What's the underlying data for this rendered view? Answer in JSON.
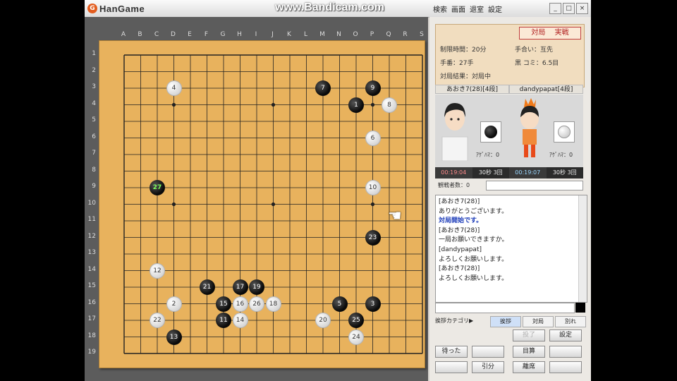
{
  "app": {
    "logo_text": "HanGame",
    "watermark": "www.Bandicam.com"
  },
  "menu": {
    "items": [
      "検索",
      "画面",
      "退室",
      "設定"
    ],
    "window_buttons": [
      "_",
      "□",
      "×"
    ]
  },
  "board": {
    "col_labels": [
      "A",
      "B",
      "C",
      "D",
      "E",
      "F",
      "G",
      "H",
      "I",
      "J",
      "K",
      "L",
      "M",
      "N",
      "O",
      "P",
      "Q",
      "R",
      "S"
    ],
    "row_labels": [
      "1",
      "2",
      "3",
      "4",
      "5",
      "6",
      "7",
      "8",
      "9",
      "10",
      "11",
      "12",
      "13",
      "14",
      "15",
      "16",
      "17",
      "18",
      "19"
    ],
    "stones": [
      {
        "n": "1",
        "color": "b",
        "col": 15,
        "row": 4
      },
      {
        "n": "2",
        "color": "w",
        "col": 4,
        "row": 16
      },
      {
        "n": "3",
        "color": "b",
        "col": 16,
        "row": 16
      },
      {
        "n": "4",
        "color": "w",
        "col": 4,
        "row": 3
      },
      {
        "n": "5",
        "color": "b",
        "col": 14,
        "row": 16
      },
      {
        "n": "6",
        "color": "w",
        "col": 16,
        "row": 6
      },
      {
        "n": "7",
        "color": "b",
        "col": 13,
        "row": 3
      },
      {
        "n": "8",
        "color": "w",
        "col": 17,
        "row": 4
      },
      {
        "n": "9",
        "color": "b",
        "col": 16,
        "row": 3
      },
      {
        "n": "10",
        "color": "w",
        "col": 16,
        "row": 9
      },
      {
        "n": "11",
        "color": "b",
        "col": 7,
        "row": 17
      },
      {
        "n": "12",
        "color": "w",
        "col": 3,
        "row": 14
      },
      {
        "n": "13",
        "color": "b",
        "col": 4,
        "row": 18
      },
      {
        "n": "14",
        "color": "w",
        "col": 8,
        "row": 17
      },
      {
        "n": "15",
        "color": "b",
        "col": 7,
        "row": 16
      },
      {
        "n": "16",
        "color": "w",
        "col": 8,
        "row": 16
      },
      {
        "n": "17",
        "color": "b",
        "col": 8,
        "row": 15
      },
      {
        "n": "18",
        "color": "w",
        "col": 10,
        "row": 16
      },
      {
        "n": "19",
        "color": "b",
        "col": 9,
        "row": 15
      },
      {
        "n": "20",
        "color": "w",
        "col": 13,
        "row": 17
      },
      {
        "n": "21",
        "color": "b",
        "col": 6,
        "row": 15
      },
      {
        "n": "22",
        "color": "w",
        "col": 3,
        "row": 17
      },
      {
        "n": "23",
        "color": "b",
        "col": 16,
        "row": 12
      },
      {
        "n": "24",
        "color": "w",
        "col": 15,
        "row": 18
      },
      {
        "n": "25",
        "color": "b",
        "col": 15,
        "row": 17
      },
      {
        "n": "26",
        "color": "w",
        "col": 9,
        "row": 16
      },
      {
        "n": "27",
        "color": "b",
        "col": 3,
        "row": 9,
        "last": true
      }
    ]
  },
  "panel": {
    "stamp": "対局 　実戦",
    "info": {
      "time_limit": "制限時間：20分",
      "handicap": "手合い：互先",
      "move_no": "手番：27手",
      "komi": "黒 コミ：6.5目",
      "result": "対局結果：対局中"
    },
    "players": {
      "black": "あおき7(28)[4段]",
      "white": "dandypapat[4段]"
    },
    "agehama_black": "ｱｹﾞﾊﾏ：0",
    "agehama_white": "ｱｹﾞﾊﾏ：0",
    "timers": {
      "black_main": "00:19:04",
      "black_byoyomi": "30秒 3回",
      "white_main": "00:19:07",
      "white_byoyomi": "30秒 3回"
    },
    "kibitz_label": "観戦者数：0",
    "chat": [
      {
        "text": "[あおき7(28)]",
        "style": "normal"
      },
      {
        "text": "ありがとうございます。",
        "style": "normal"
      },
      {
        "text": "対局開始です。",
        "style": "system"
      },
      {
        "text": "[あおき7(28)]",
        "style": "normal"
      },
      {
        "text": "一局お願いできますか。",
        "style": "normal"
      },
      {
        "text": "[dandypapat]",
        "style": "normal"
      },
      {
        "text": "よろしくお願いします。",
        "style": "normal"
      },
      {
        "text": "[あおき7(28)]",
        "style": "normal"
      },
      {
        "text": "よろしくお願いします。",
        "style": "normal"
      }
    ],
    "tabs": [
      "挨拶カテゴリ▶",
      "挨拶",
      "対局",
      "別れ"
    ],
    "buttons": [
      {
        "label": "投了",
        "disabled": true
      },
      {
        "label": "設定",
        "disabled": false
      },
      {
        "label": "待った",
        "disabled": false
      },
      {
        "label": "",
        "disabled": true
      },
      {
        "label": "目算",
        "disabled": false
      },
      {
        "label": "",
        "disabled": true
      },
      {
        "label": "",
        "disabled": true
      },
      {
        "label": "引分",
        "disabled": false
      },
      {
        "label": "離席",
        "disabled": false
      },
      {
        "label": "",
        "disabled": true
      }
    ]
  },
  "colors": {
    "board": "#e8b25d",
    "black_stone": "#0a0a0a",
    "white_stone": "#ffffff",
    "last_move_text": "#7dff5b"
  },
  "icons": [
    "hand-cursor-icon",
    "hangame-logo-icon"
  ]
}
